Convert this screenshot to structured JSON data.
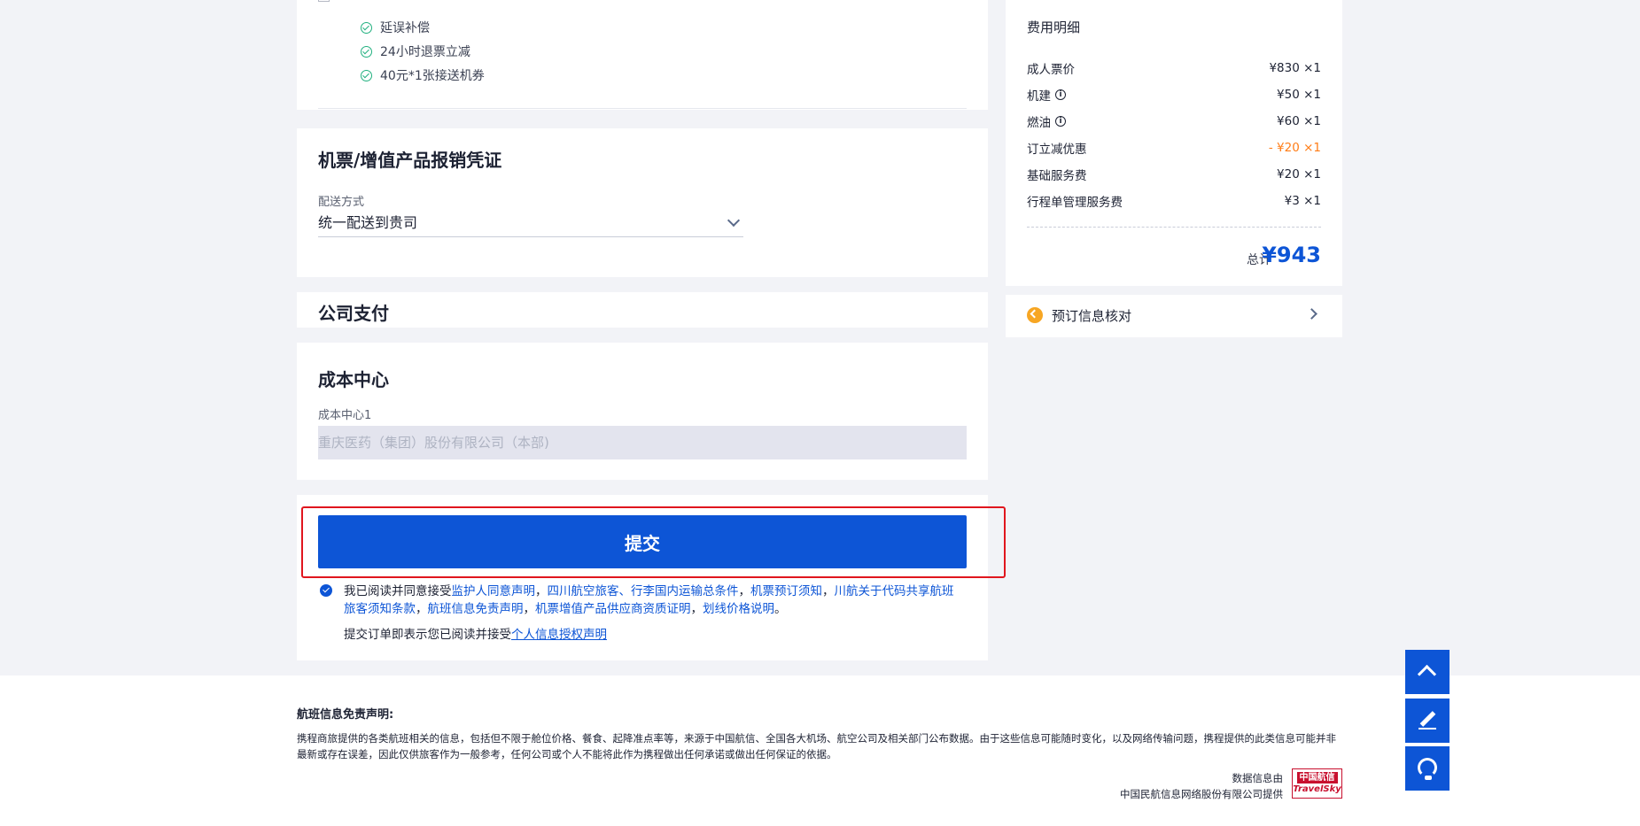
{
  "insurance": {
    "items": [
      {
        "label": "延误补偿"
      },
      {
        "label": "24小时退票立减"
      },
      {
        "label": "40元*1张接送机券"
      }
    ]
  },
  "voucher": {
    "title": "机票/增值产品报销凭证",
    "delivery_label": "配送方式",
    "delivery_value": "统一配送到贵司"
  },
  "company_pay": {
    "title": "公司支付"
  },
  "cost_center": {
    "title": "成本中心",
    "field_label": "成本中心1",
    "field_value": "重庆医药（集团）股份有限公司（本部)"
  },
  "submit": {
    "button_label": "提交",
    "agree_prefix": "我已阅读并同意接受",
    "agree_links": [
      "监护人同意声明",
      "四川航空旅客、行李国内运输总条件",
      "机票预订须知",
      "川航关于代码共享航班旅客须知条款",
      "航班信息免责声明",
      "机票增值产品供应商资质证明",
      "划线价格说明"
    ],
    "sep": "，",
    "end": "。",
    "privacy_prefix": "提交订单即表示您已阅读并接受",
    "privacy_link": "个人信息授权声明"
  },
  "fee": {
    "title": "费用明细",
    "rows": [
      {
        "name": "成人票价",
        "value": "¥830 ×1",
        "info": false,
        "discount": false
      },
      {
        "name": "机建",
        "value": "¥50 ×1",
        "info": true,
        "discount": false
      },
      {
        "name": "燃油",
        "value": "¥60 ×1",
        "info": true,
        "discount": false
      },
      {
        "name": "订立减优惠",
        "value": "- ¥20 ×1",
        "info": false,
        "discount": true
      },
      {
        "name": "基础服务费",
        "value": "¥20 ×1",
        "info": false,
        "discount": false
      },
      {
        "name": "行程单管理服务费",
        "value": "¥3 ×1",
        "info": false,
        "discount": false
      }
    ],
    "total_label": "总计",
    "total_value": "¥943",
    "discount_color": "#ff7d17",
    "accent_color": "#0d55d6"
  },
  "verify": {
    "label": "预订信息核对"
  },
  "footer": {
    "title": "航班信息免责声明:",
    "text": "携程商旅提供的各类航班相关的信息，包括但不限于舱位价格、餐食、起降准点率等，来源于中国航信、全国各大机场、航空公司及相关部门公布数据。由于这些信息可能随时变化，以及网络传输问题，携程提供的此类信息可能并非最新或存在误差，因此仅供旅客作为一般参考，任何公司或个人不能将此作为携程做出任何承诺或做出任何保证的依据。",
    "source_line1": "数据信息由",
    "source_line2": "中国民航信息网络股份有限公司提供",
    "logo_cn": "中国航信",
    "logo_en": "TravelSky"
  },
  "floating": {
    "icons": [
      "chevron-up-icon",
      "edit-icon",
      "headset-icon"
    ]
  }
}
